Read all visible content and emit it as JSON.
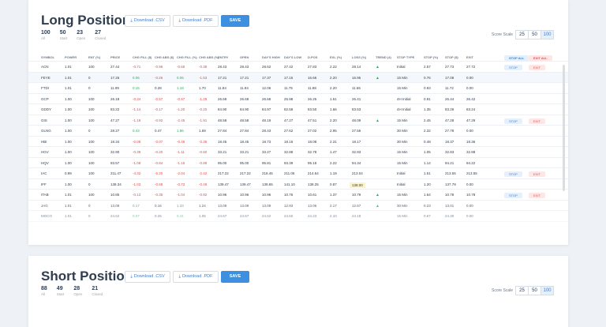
{
  "long": {
    "title": "Long Positions",
    "csv_label": "Download .CSV",
    "pdf_label": "Download .PDF",
    "save_label": "SAVE",
    "stats": [
      {
        "value": "100",
        "label": "All"
      },
      {
        "value": "50",
        "label": "Start"
      },
      {
        "value": "23",
        "label": "Open"
      },
      {
        "value": "27",
        "label": "Closed"
      }
    ],
    "scale_label": "Score Scale",
    "scale_options": [
      "25",
      "50",
      "100"
    ],
    "scale_selected": "100",
    "columns": [
      "SYMBOL",
      "POWER",
      "ENT (%)",
      "PRICE",
      "CHG FILL ($)",
      "CHG ABS ($)",
      "CHG FILL (%)",
      "CHG ABS (%)",
      "ENTRY",
      "OPEN",
      "DAY'S HIGH",
      "DAY'S LOW",
      "D.POS",
      "EXL (%)",
      "LOSS (%)",
      "TREND (4)",
      "STOP TYPE",
      "STOP (%)",
      "STOP ($)",
      "EXIT",
      "STOP ALL",
      "EXIT ALL"
    ],
    "rows": [
      [
        "ACN",
        "1.01",
        "100",
        "27.44",
        "-0.71",
        "-0.96",
        "-0.65",
        "-0.38",
        "28.43",
        "28.43",
        "28.62",
        "27.42",
        "27.83",
        "2.22",
        "28.14",
        "▲",
        "Initial",
        "2.57",
        "27.73",
        "27.72",
        "STOP",
        "EXIT"
      ],
      [
        "FEYE",
        "1.01",
        "0",
        "17.26",
        "0.05",
        "-0.26",
        "0.05",
        "-1.53",
        "17.21",
        "17.21",
        "17.37",
        "17.15",
        "16.66",
        "2.20",
        "16.95",
        "▲",
        "15 Min",
        "0.76",
        "17.08",
        "0.00",
        "",
        ""
      ],
      [
        "FTDI",
        "1.01",
        "0",
        "11.99",
        "0.15",
        "0.28",
        "1.18",
        "1.70",
        "11.84",
        "11.84",
        "12.06",
        "11.75",
        "11.88",
        "2.20",
        "11.66",
        "",
        "15 Min",
        "0.93",
        "11.72",
        "0.00",
        "",
        ""
      ],
      [
        "GCP",
        "1.00",
        "100",
        "26.18",
        "-0.34",
        "-0.57",
        "-0.97",
        "-1.29",
        "26.69",
        "26.69",
        "26.68",
        "25.98",
        "26.25",
        "1.61",
        "26.41",
        "",
        "4H Initial",
        "0.91",
        "26.44",
        "26.42",
        "",
        ""
      ],
      [
        "GDDY",
        "1.00",
        "100",
        "83.22",
        "-1.14",
        "-0.17",
        "-1.20",
        "-0.20",
        "84.90",
        "84.90",
        "84.97",
        "82.58",
        "83.50",
        "1.66",
        "83.53",
        "",
        "4H Initial",
        "1.35",
        "83.26",
        "83.24",
        "",
        ""
      ],
      [
        "GIS",
        "1.00",
        "100",
        "47.27",
        "-1.19",
        "-0.92",
        "-2.45",
        "-1.91",
        "48.58",
        "48.58",
        "48.19",
        "47.27",
        "47.51",
        "2.20",
        "48.09",
        "▲",
        "15 Min",
        "2.45",
        "47.28",
        "47.29",
        "STOP",
        "EXIT"
      ],
      [
        "GLNG",
        "1.00",
        "0",
        "28.27",
        "0.43",
        "0.47",
        "1.86",
        "1.69",
        "27.84",
        "27.84",
        "28.43",
        "27.62",
        "27.02",
        "2.95",
        "27.56",
        "",
        "30 Min",
        "2.32",
        "27.78",
        "0.00",
        "",
        ""
      ],
      [
        "HBI",
        "1.00",
        "100",
        "18.34",
        "-0.09",
        "-0.07",
        "-0.49",
        "-0.38",
        "18.45",
        "18.45",
        "18.73",
        "18.16",
        "18.08",
        "2.31",
        "18.17",
        "",
        "30 Min",
        "0.48",
        "18.37",
        "18.36",
        "",
        ""
      ],
      [
        "HGV",
        "1.00",
        "100",
        "32.90",
        "-0.39",
        "-0.20",
        "-1.11",
        "-0.60",
        "33.21",
        "33.21",
        "33.27",
        "32.88",
        "32.78",
        "1.47",
        "32.93",
        "",
        "15 Min",
        "1.05",
        "32.83",
        "32.88",
        "",
        ""
      ],
      [
        "HQV",
        "1.00",
        "100",
        "93.57",
        "-1.08",
        "-0.84",
        "-1.15",
        "-0.89",
        "95.00",
        "95.00",
        "95.81",
        "93.39",
        "95.18",
        "2.22",
        "94.34",
        "",
        "15 Min",
        "1.14",
        "94.21",
        "94.22",
        "",
        ""
      ],
      [
        "IAC",
        "0.99",
        "100",
        "211.47",
        "-4.32",
        "-5.20",
        "-2.04",
        "-2.42",
        "217.22",
        "217.22",
        "218.45",
        "211.06",
        "214.64",
        "1.19",
        "213.04",
        "",
        "Initial",
        "1.51",
        "213.55",
        "213.55",
        "STOP",
        "EXIT"
      ],
      [
        "IFF",
        "1.00",
        "0",
        "138.34",
        "-1.03",
        "-0.68",
        "-0.73",
        "-0.49",
        "139.47",
        "139.47",
        "139.65",
        "141.10",
        "138.25",
        "0.87",
        "138.00",
        "",
        "Initial",
        "1.20",
        "137.79",
        "0.00",
        "",
        ""
      ],
      [
        "ITAB",
        "1.01",
        "100",
        "10.85",
        "-0.13",
        "-0.35",
        "-1.04",
        "-0.92",
        "10.96",
        "10.96",
        "10.96",
        "10.76",
        "10.61",
        "1.37",
        "10.79",
        "▲",
        "15 Min",
        "1.64",
        "10.78",
        "10.78",
        "STOP",
        "EXIT"
      ],
      [
        "JAG",
        "1.01",
        "0",
        "13.09",
        "0.17",
        "0.16",
        "1.33",
        "1.24",
        "13.09",
        "13.09",
        "13.09",
        "12.93",
        "13.06",
        "2.17",
        "12.67",
        "▲",
        "30 Min",
        "0.23",
        "13.01",
        "0.00",
        "",
        ""
      ],
      [
        "MOCO",
        "1.01",
        "0",
        "24.62",
        "0.07",
        "0.26",
        "0.41",
        "1.05",
        "24.67",
        "24.67",
        "24.62",
        "24.50",
        "24.23",
        "2.10",
        "24.18",
        "",
        "15 Min",
        "0.67",
        "24.30",
        "0.00",
        "",
        ""
      ]
    ]
  },
  "short": {
    "title": "Short Positions",
    "csv_label": "Download .CSV",
    "pdf_label": "Download .PDF",
    "save_label": "SAVE",
    "stats": [
      {
        "value": "88",
        "label": "All"
      },
      {
        "value": "49",
        "label": "Start"
      },
      {
        "value": "28",
        "label": "Open"
      },
      {
        "value": "21",
        "label": "Closed"
      }
    ],
    "scale_label": "Score Scale",
    "scale_options": [
      "25",
      "50",
      "100"
    ],
    "scale_selected": "100"
  },
  "colors": {
    "accent": "#3d8fe0",
    "negative": "#e04e4e",
    "positive": "#2faa5f",
    "highlight": "#fbf3c9"
  }
}
